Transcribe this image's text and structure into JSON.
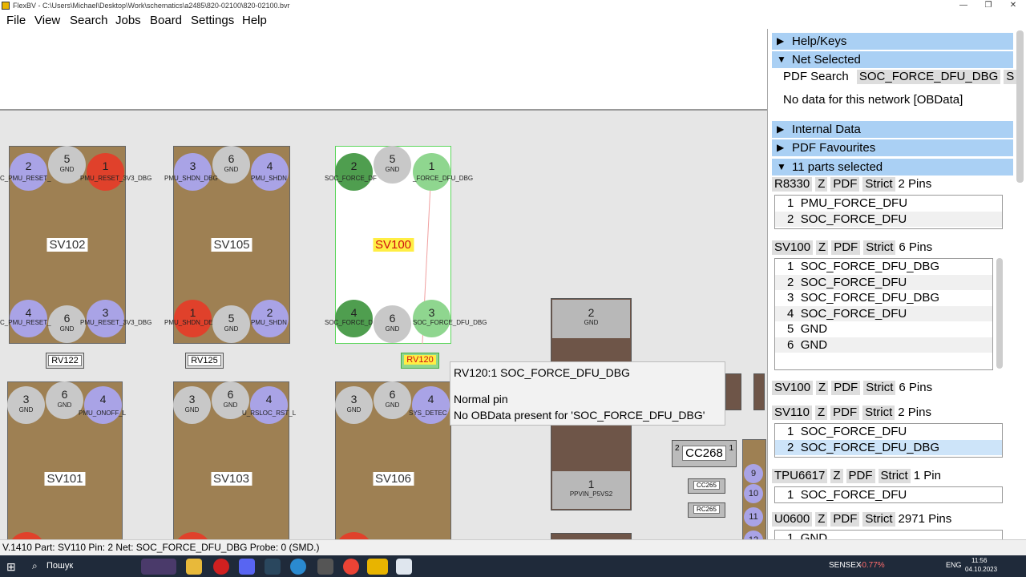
{
  "window": {
    "title": "FlexBV - C:\\Users\\Michael\\Desktop\\Work\\schematics\\a2485\\820-02100\\820-02100.bvr"
  },
  "menu": [
    "File",
    "View",
    "Search",
    "Jobs",
    "Board",
    "Settings",
    "Help"
  ],
  "board": {
    "parts": [
      {
        "name": "SV102",
        "pins": [
          {
            "n": "2",
            "net": "",
            "color": "#a9a3e6"
          },
          {
            "n": "5",
            "net": "GND",
            "color": "#c8c8c8"
          },
          {
            "n": "1",
            "net": "",
            "color": "#e0412b"
          },
          {
            "n": "4",
            "net": "",
            "color": "#a9a3e6"
          },
          {
            "n": "6",
            "net": "GND",
            "color": "#c8c8c8"
          },
          {
            "n": "3",
            "net": "",
            "color": "#a9a3e6"
          }
        ],
        "top_labels": [
          "C_PMU_RESET_",
          "PMU_RESET_3V3_DBG"
        ],
        "bot_labels": [
          "C_PMU_RESET_",
          "PMU_RESET_3V3_DBG"
        ]
      },
      {
        "name": "SV105",
        "pins": [
          {
            "n": "3",
            "net": "",
            "color": "#a9a3e6"
          },
          {
            "n": "6",
            "net": "GND",
            "color": "#c8c8c8"
          },
          {
            "n": "4",
            "net": "",
            "color": "#a9a3e6"
          },
          {
            "n": "1",
            "net": "",
            "color": "#e0412b"
          },
          {
            "n": "5",
            "net": "GND",
            "color": "#c8c8c8"
          },
          {
            "n": "2",
            "net": "",
            "color": "#a9a3e6"
          }
        ],
        "top_labels": [
          "PMU_SHDN_DBG",
          "PMU_SHDN"
        ],
        "bot_labels": [
          "PMU_SHDN_DE",
          "PMU_SHDN"
        ]
      },
      {
        "name": "SV100",
        "pins": [
          {
            "n": "2",
            "net": "",
            "color": "#4f9e4f"
          },
          {
            "n": "5",
            "net": "GND",
            "color": "#c8c8c8"
          },
          {
            "n": "1",
            "net": "",
            "color": "#8fd68f"
          },
          {
            "n": "4",
            "net": "",
            "color": "#4f9e4f"
          },
          {
            "n": "6",
            "net": "GND",
            "color": "#c8c8c8"
          },
          {
            "n": "3",
            "net": "",
            "color": "#8fd68f"
          }
        ],
        "top_labels": [
          "SOC_FORCE_DF",
          "_FORCE_DFU_DBG"
        ],
        "bot_labels": [
          "SOC_FORCE_D",
          "SOC_FORCE_DFU_DBG"
        ]
      },
      {
        "name": "SV101",
        "pins": [
          {
            "n": "3",
            "net": "GND",
            "color": "#c8c8c8"
          },
          {
            "n": "6",
            "net": "GND",
            "color": "#c8c8c8"
          },
          {
            "n": "4",
            "net": "",
            "color": "#a9a3e6"
          }
        ],
        "top_labels": [
          "",
          "PMU_ONOFF_L"
        ]
      },
      {
        "name": "SV103",
        "pins": [
          {
            "n": "3",
            "net": "GND",
            "color": "#c8c8c8"
          },
          {
            "n": "6",
            "net": "GND",
            "color": "#c8c8c8"
          },
          {
            "n": "4",
            "net": "",
            "color": "#a9a3e6"
          }
        ],
        "top_labels": [
          "",
          "U_RSLOC_RST_L"
        ]
      },
      {
        "name": "SV106",
        "pins": [
          {
            "n": "3",
            "net": "GND",
            "color": "#c8c8c8"
          },
          {
            "n": "6",
            "net": "GND",
            "color": "#c8c8c8"
          },
          {
            "n": "4",
            "net": "",
            "color": "#a9a3e6"
          }
        ],
        "top_labels": [
          "",
          "SYS_DETEC"
        ]
      }
    ],
    "small_parts": [
      "RV122",
      "RV125",
      "RV120",
      "CC268",
      "CC265",
      "RC265"
    ],
    "big_part": {
      "pin_top": "2",
      "net_top": "GND",
      "pin_bottom": "1",
      "net_bottom": "PPVIN_P5VS2"
    },
    "cc268_pins": [
      "2",
      "1"
    ],
    "side_pins": [
      "9",
      "10",
      "11",
      "12"
    ]
  },
  "tooltip": {
    "line1": "RV120:1  SOC_FORCE_DFU_DBG",
    "line2": "Normal pin",
    "line3": "No OBData present for 'SOC_FORCE_DFU_DBG'"
  },
  "panel": {
    "help": "Help/Keys",
    "net_selected": "Net Selected",
    "pdf_search_label": "PDF Search",
    "pdf_search_value": "SOC_FORCE_DFU_DBG",
    "pdf_search_more": "S",
    "no_data": "No data for this network [OBData]",
    "internal_data": "Internal Data",
    "pdf_favourites": "PDF Favourites",
    "parts_selected": "11 parts selected",
    "parts": [
      {
        "name": "R8330",
        "pins_text": "2 Pins",
        "rows": [
          {
            "n": "1",
            "net": "PMU_FORCE_DFU"
          },
          {
            "n": "2",
            "net": "SOC_FORCE_DFU"
          }
        ]
      },
      {
        "name": "SV100",
        "pins_text": "6 Pins",
        "rows": [
          {
            "n": "1",
            "net": "SOC_FORCE_DFU_DBG"
          },
          {
            "n": "2",
            "net": "SOC_FORCE_DFU"
          },
          {
            "n": "3",
            "net": "SOC_FORCE_DFU_DBG"
          },
          {
            "n": "4",
            "net": "SOC_FORCE_DFU"
          },
          {
            "n": "5",
            "net": "GND"
          },
          {
            "n": "6",
            "net": "GND"
          }
        ]
      },
      {
        "name": "SV100",
        "pins_text": "6 Pins",
        "rows": []
      },
      {
        "name": "SV110",
        "pins_text": "2 Pins",
        "rows": [
          {
            "n": "1",
            "net": "SOC_FORCE_DFU"
          },
          {
            "n": "2",
            "net": "SOC_FORCE_DFU_DBG"
          }
        ]
      },
      {
        "name": "TPU6617",
        "pins_text": "1 Pin",
        "rows": [
          {
            "n": "1",
            "net": "SOC_FORCE_DFU"
          }
        ]
      },
      {
        "name": "U0600",
        "pins_text": "2971 Pins",
        "rows": [
          {
            "n": "1",
            "net": "GND"
          }
        ]
      }
    ],
    "btn_z": "Z",
    "btn_pdf": "PDF",
    "btn_strict": "Strict"
  },
  "status": "V.1410  Part: SV110   Pin: 2   Net: SOC_FORCE_DFU_DBG   Probe: 0   (SMD.)",
  "taskbar": {
    "search": "Пошук",
    "ticker": "SENSEX",
    "ticker_change": "-0.77%",
    "lang": "ENG",
    "time": "11:56",
    "date": "04.10.2023"
  }
}
